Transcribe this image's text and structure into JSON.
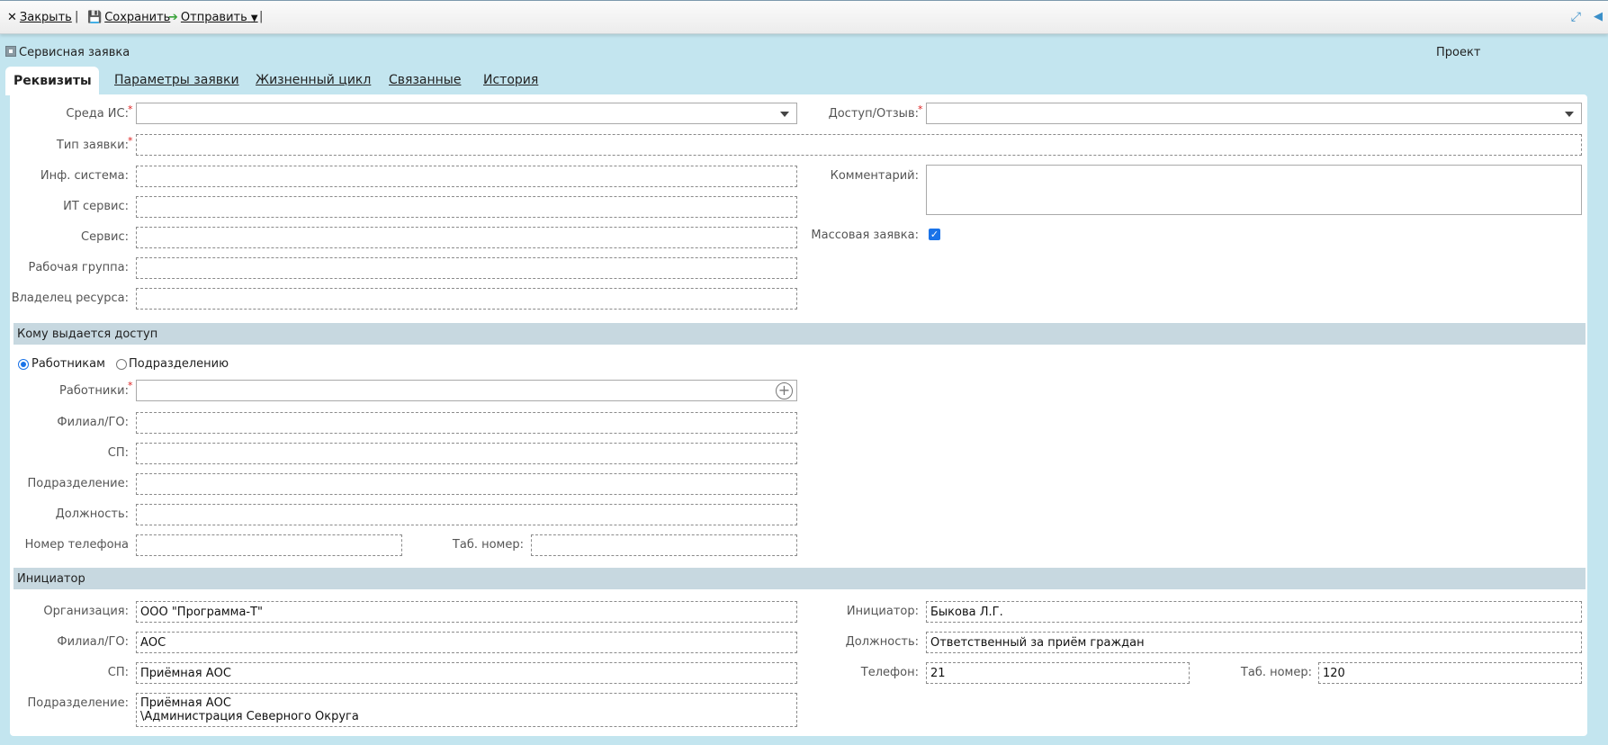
{
  "toolbar": {
    "close_label": "Закрыть",
    "save_label": "Сохранить",
    "send_label": "Отправить"
  },
  "document": {
    "title": "Сервисная заявка",
    "status": "Проект"
  },
  "tabs": [
    {
      "label": "Реквизиты"
    },
    {
      "label": "Параметры заявки"
    },
    {
      "label": "Жизненный цикл"
    },
    {
      "label": "Связанные"
    },
    {
      "label": "История"
    }
  ],
  "requisites": {
    "is_env_label": "Среда ИС:",
    "access_label": "Доступ/Отзыв:",
    "request_type_label": "Тип заявки:",
    "info_system_label": "Инф. система:",
    "it_service_label": "ИТ сервис:",
    "service_label": "Сервис:",
    "work_group_label": "Рабочая группа:",
    "resource_owner_label": "Владелец ресурса:",
    "comment_label": "Комментарий:",
    "mass_request_label": "Массовая заявка:",
    "mass_request_checked": true
  },
  "access_to": {
    "section_title": "Кому выдается доступ",
    "radio_employees": "Работникам",
    "radio_department": "Подразделению",
    "selected": "employees",
    "employees_label": "Работники:",
    "branch_label": "Филиал/ГО:",
    "sp_label": "СП:",
    "department_label": "Подразделение:",
    "position_label": "Должность:",
    "phone_label": "Номер телефона",
    "tab_number_label": "Таб. номер:"
  },
  "initiator": {
    "section_title": "Инициатор",
    "organization_label": "Организация:",
    "organization_value": "ООО \"Программа-Т\"",
    "branch_label": "Филиал/ГО:",
    "branch_value": "АОС",
    "sp_label": "СП:",
    "sp_value": "Приёмная АОС",
    "department_label": "Подразделение:",
    "department_value": "Приёмная АОС\n\\Администрация Северного Округа",
    "initiator_label": "Инициатор:",
    "initiator_value": "Быкова Л.Г.",
    "position_label": "Должность:",
    "position_value": "Ответственный за приём граждан",
    "phone_label": "Телефон:",
    "phone_value": "21",
    "tab_number_label": "Таб. номер:",
    "tab_number_value": "120"
  },
  "colors": {
    "background": "#c3e5ef",
    "section_bar": "#c7d8e0",
    "required_mark": "#dd2222",
    "accent": "#1a73e8"
  }
}
